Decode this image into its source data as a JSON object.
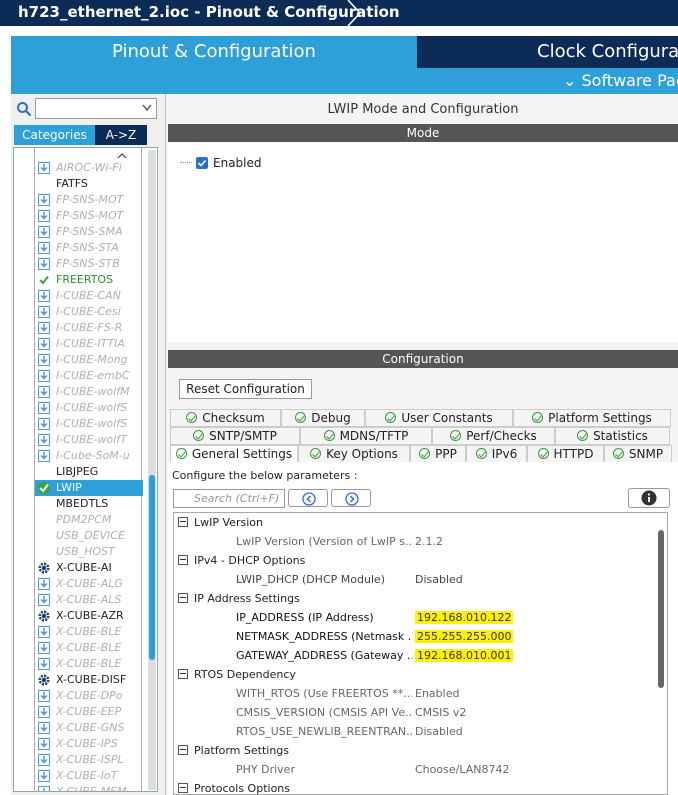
{
  "window": {
    "title": "h723_ethernet_2.ioc - Pinout & Configuration"
  },
  "main_tabs": {
    "pinout": "Pinout & Configuration",
    "clock": "Clock Configurat"
  },
  "software_packs": "⌄ Software Pack",
  "left": {
    "categories_label": "Categories",
    "az_label": "A->Z",
    "items": [
      {
        "label": "AIROC-Wi-Fi",
        "style": "gray",
        "icon": "download-icon"
      },
      {
        "label": "FATFS",
        "style": "dark",
        "icon": ""
      },
      {
        "label": "FP-SNS-MOT",
        "style": "gray",
        "icon": "download-icon"
      },
      {
        "label": "FP-SNS-MOT",
        "style": "gray",
        "icon": "download-icon"
      },
      {
        "label": "FP-SNS-SMA",
        "style": "gray",
        "icon": "download-icon"
      },
      {
        "label": "FP-SNS-STA",
        "style": "gray",
        "icon": "download-icon"
      },
      {
        "label": "FP-SNS-STB",
        "style": "gray",
        "icon": "download-icon"
      },
      {
        "label": "FREERTOS",
        "style": "green",
        "icon": "check-icon"
      },
      {
        "label": "I-CUBE-CAN",
        "style": "gray",
        "icon": "download-icon"
      },
      {
        "label": "I-CUBE-Cesi",
        "style": "gray",
        "icon": "download-icon"
      },
      {
        "label": "I-CUBE-FS-R",
        "style": "gray",
        "icon": "download-icon"
      },
      {
        "label": "I-CUBE-ITTIA",
        "style": "gray",
        "icon": "download-icon"
      },
      {
        "label": "I-CUBE-Mong",
        "style": "gray",
        "icon": "download-icon"
      },
      {
        "label": "I-CUBE-embC",
        "style": "gray",
        "icon": "download-icon"
      },
      {
        "label": "I-CUBE-wolfM",
        "style": "gray",
        "icon": "download-icon"
      },
      {
        "label": "I-CUBE-wolfS",
        "style": "gray",
        "icon": "download-icon"
      },
      {
        "label": "I-CUBE-wolfS",
        "style": "gray",
        "icon": "download-icon"
      },
      {
        "label": "I-CUBE-wolfT",
        "style": "gray",
        "icon": "download-icon"
      },
      {
        "label": "I-Cube-SoM-u",
        "style": "gray",
        "icon": "download-icon"
      },
      {
        "label": "LIBJPEG",
        "style": "dark",
        "icon": ""
      },
      {
        "label": "LWIP",
        "style": "sel",
        "icon": "check-icon"
      },
      {
        "label": "MBEDTLS",
        "style": "dark",
        "icon": ""
      },
      {
        "label": "PDM2PCM",
        "style": "gray",
        "icon": ""
      },
      {
        "label": "USB_DEVICE",
        "style": "gray",
        "icon": ""
      },
      {
        "label": "USB_HOST",
        "style": "gray",
        "icon": ""
      },
      {
        "label": "X-CUBE-AI",
        "style": "dark",
        "icon": "gear-icon"
      },
      {
        "label": "X-CUBE-ALG",
        "style": "gray",
        "icon": "download-icon"
      },
      {
        "label": "X-CUBE-ALS",
        "style": "gray",
        "icon": "download-icon"
      },
      {
        "label": "X-CUBE-AZR",
        "style": "dark",
        "icon": "gear-icon"
      },
      {
        "label": "X-CUBE-BLE",
        "style": "gray",
        "icon": "download-icon"
      },
      {
        "label": "X-CUBE-BLE",
        "style": "gray",
        "icon": "download-icon"
      },
      {
        "label": "X-CUBE-BLE",
        "style": "gray",
        "icon": "download-icon"
      },
      {
        "label": "X-CUBE-DISF",
        "style": "dark",
        "icon": "gear-icon"
      },
      {
        "label": "X-CUBE-DPo",
        "style": "gray",
        "icon": "download-icon"
      },
      {
        "label": "X-CUBE-EEP",
        "style": "gray",
        "icon": "download-icon"
      },
      {
        "label": "X-CUBE-GNS",
        "style": "gray",
        "icon": "download-icon"
      },
      {
        "label": "X-CUBE-IPS",
        "style": "gray",
        "icon": "download-icon"
      },
      {
        "label": "X-CUBE-ISPL",
        "style": "gray",
        "icon": "download-icon"
      },
      {
        "label": "X-CUBE-IoT",
        "style": "gray",
        "icon": "download-icon"
      },
      {
        "label": "X-CUBE-MEM",
        "style": "gray",
        "icon": "download-icon"
      }
    ]
  },
  "right": {
    "header": "LWIP Mode and Configuration",
    "mode_bar": "Mode",
    "enabled_label": "Enabled",
    "config_bar": "Configuration",
    "reset_button": "Reset Configuration",
    "tabs_row1": [
      "Checksum",
      "Debug",
      "User Constants",
      "Platform Settings"
    ],
    "tabs_row2": [
      "SNTP/SMTP",
      "MDNS/TFTP",
      "Perf/Checks",
      "Statistics"
    ],
    "tabs_row3": [
      "General Settings",
      "Key Options",
      "PPP",
      "IPv6",
      "HTTPD",
      "SNMP"
    ],
    "configure_label": "Configure the below parameters :",
    "search_placeholder": "Search (Ctrl+F)",
    "sections": [
      {
        "title": "LwIP Version",
        "params": [
          {
            "name": "LwIP Version (Version of LwIP s...",
            "value": "2.1.2",
            "dim": true
          }
        ]
      },
      {
        "title": "IPv4 - DHCP Options",
        "params": [
          {
            "name": "LWIP_DHCP (DHCP Module)",
            "value": "Disabled",
            "dim": false
          }
        ]
      },
      {
        "title": "IP Address Settings",
        "params": [
          {
            "name": "IP_ADDRESS (IP Address)",
            "value": "192.168.010.122",
            "hl": true
          },
          {
            "name": "NETMASK_ADDRESS (Netmask ...",
            "value": "255.255.255.000",
            "hl": true
          },
          {
            "name": "GATEWAY_ADDRESS (Gateway ...",
            "value": "192.168.010.001",
            "hl": true
          }
        ]
      },
      {
        "title": "RTOS Dependency",
        "params": [
          {
            "name": "WITH_RTOS (Use FREERTOS **...",
            "value": "Enabled",
            "dim": true
          },
          {
            "name": "CMSIS_VERSION (CMSIS API Ve...",
            "value": "CMSIS v2",
            "dim": true
          },
          {
            "name": "RTOS_USE_NEWLIB_REENTRAN...",
            "value": "Disabled",
            "dim": true
          }
        ]
      },
      {
        "title": "Platform Settings",
        "params": [
          {
            "name": "PHY Driver",
            "value": "Choose/LAN8742",
            "dim": true
          }
        ]
      },
      {
        "title": "Protocols Options",
        "params": []
      }
    ]
  }
}
